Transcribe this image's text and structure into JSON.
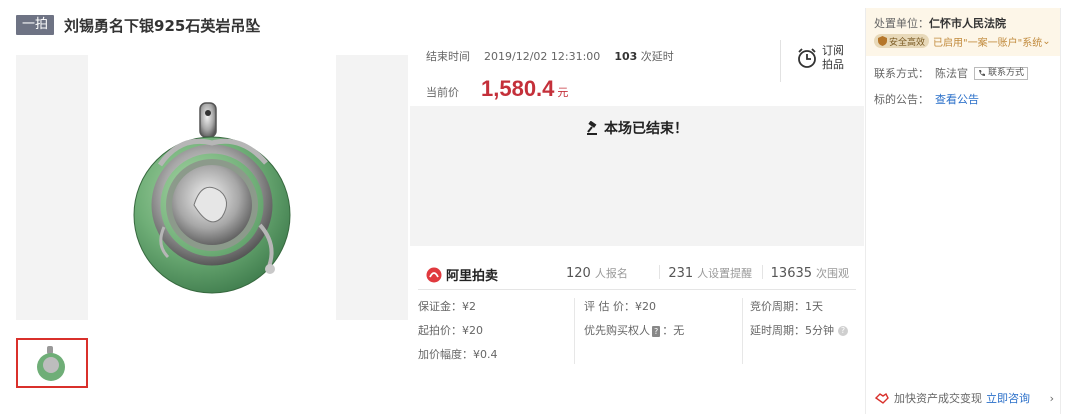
{
  "header": {
    "tag": "一拍",
    "title": "刘锡勇名下银925石英岩吊坠"
  },
  "auction": {
    "end_label": "结束时间",
    "end_time": "2019/12/02 12:31:00",
    "delay_count": "103",
    "delay_label": "次延时",
    "price_label": "当前价",
    "price": "1,580.4",
    "price_unit": "元",
    "subscribe_label": "订阅拍品",
    "ended_text": "本场已结束！",
    "logo_text": "阿里拍卖"
  },
  "stats": [
    {
      "value": "120",
      "label": "人报名"
    },
    {
      "value": "231",
      "label": "人设置提醒"
    },
    {
      "value": "13635",
      "label": "次围观"
    }
  ],
  "info": {
    "deposit": "保证金：¥2",
    "start_price": "起拍价：¥20",
    "increment": "加价幅度：¥0.4",
    "appraisal": "评 估 价：¥20",
    "priority_label": "优先购买权人",
    "priority_icon": "?",
    "priority_value": "：无",
    "bid_period": "竞价周期：1天",
    "delay_period": "延时周期：5分钟"
  },
  "sidebar": {
    "unit_label": "处置单位：",
    "unit_value": "仁怀市人民法院",
    "safe_badge": "安全高效",
    "system_text": "已启用\"一案一账户\"系统",
    "contact_label": "联系方式：",
    "contact_name": "陈法官",
    "contact_button": "联系方式",
    "notice_label": "标的公告：",
    "notice_link": "查看公告",
    "bottom_text": "加快资产成交变现",
    "bottom_link": "立即咨询"
  },
  "colors": {
    "price_red": "#c4303a",
    "link_blue": "#2a6fc9",
    "thumb_border": "#d9302b",
    "sidebar_bg": "#fdf6e8"
  }
}
